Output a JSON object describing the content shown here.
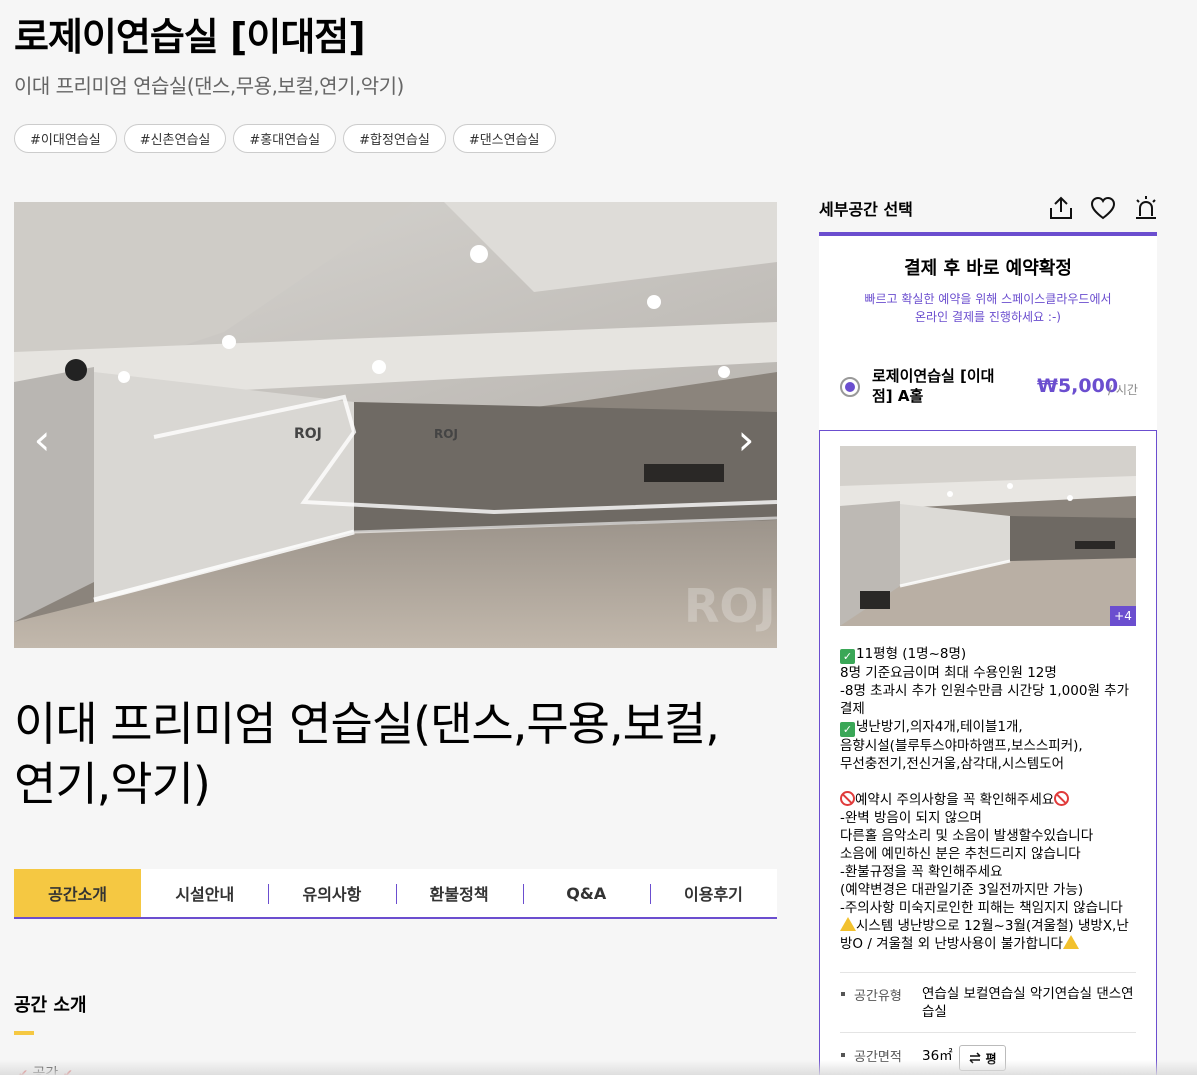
{
  "header": {
    "title": "로제이연습실 [이대점]",
    "subtitle": "이대 프리미엄 연습실(댄스,무용,보컬,연기,악기)"
  },
  "tags": [
    "#이대연습실",
    "#신촌연습실",
    "#홍대연습실",
    "#합정연습실",
    "#댄스연습실"
  ],
  "gallery": {
    "prev_icon": "chevron-left-icon",
    "next_icon": "chevron-right-icon",
    "prev_glyph": "‹",
    "next_glyph": "›"
  },
  "main": {
    "big_title": "이대 프리미엄 연습실(댄스,무용,보컬,연기,악기)",
    "tabs": [
      "공간소개",
      "시설안내",
      "유의사항",
      "환불정책",
      "Q&A",
      "이용후기"
    ],
    "active_tab": "공간소개",
    "section_title": "공간 소개",
    "section_cut_text": "공간"
  },
  "panel": {
    "label": "세부공간 선택",
    "icons": [
      "share-icon",
      "heart-icon",
      "siren-icon"
    ],
    "confirm_title": "결제 후 바로 예약확정",
    "confirm_desc_line1": "빠르고 확실한 예약을 위해 스페이스클라우드에서",
    "confirm_desc_line2": "온라인 결제를 진행하세요 :-)",
    "room_name": "로제이연습실 [이대점] A홀",
    "price": "₩5,000",
    "price_unit": "/ 시간",
    "photo_more": "+4",
    "desc_lines": [
      "11평형 (1명~8명)",
      "8명 기준요금이며 최대 수용인원 12명",
      "-8명 초과시 추가 인원수만큼 시간당 1,000원 추가결제",
      "냉난방기,의자4개,테이블1개,",
      "음향시설(블루투스야마하앰프,보스스피커),",
      "무선충전기,전신거울,삼각대,시스템도어",
      "",
      "예약시 주의사항을 꼭 확인해주세요",
      "-완벽 방음이 되지 않으며",
      "다른홀 음악소리 및 소음이 발생할수있습니다",
      "소음에 예민하신 분은 추천드리지 않습니다",
      "-환불규정을 꼭 확인해주세요",
      "(예약변경은 대관일기준 3일전까지만 가능)",
      "-주의사항 미숙지로인한 피해는 책임지지 않습니다",
      "시스템 냉난방으로 12월~3월(겨울철) 냉방X,난방O / 겨울철 외 난방사용이 불가합니다"
    ],
    "info": [
      {
        "label": "공간유형",
        "value": "연습실 보컬연습실 악기연습실 댄스연습실"
      },
      {
        "label": "공간면적",
        "value": "36㎡"
      }
    ],
    "unit_toggle": "평",
    "unit_toggle_icon": "swap-icon"
  },
  "colors": {
    "accent": "#6b4ecf",
    "tab_active": "#f5c842",
    "background": "#f6f6f6"
  }
}
